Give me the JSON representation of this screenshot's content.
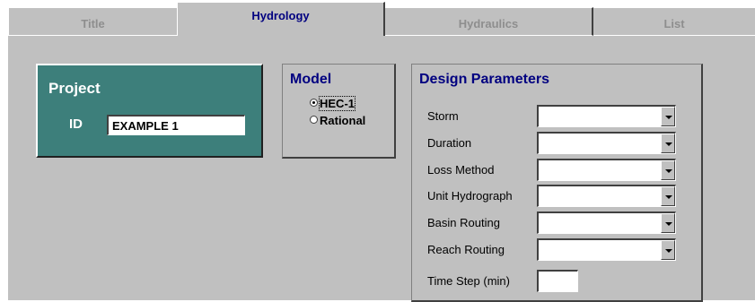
{
  "tabs": [
    {
      "label": "Title"
    },
    {
      "label": "Hydrology"
    },
    {
      "label": "Hydraulics"
    },
    {
      "label": "List"
    }
  ],
  "active_tab": "Hydrology",
  "colors": {
    "active_tab_text": "#000080",
    "inactive_tab_text": "#8e8e8e",
    "project_panel_bg": "#3d7f7b",
    "panel_title": "#000080",
    "window_bg": "#c0c0c0"
  },
  "project": {
    "title": "Project",
    "id_label": "ID",
    "id_value": "EXAMPLE 1"
  },
  "model": {
    "title": "Model",
    "options": [
      {
        "label": "HEC-1",
        "selected": true
      },
      {
        "label": "Rational",
        "selected": false
      }
    ]
  },
  "design_parameters": {
    "title": "Design Parameters",
    "fields": [
      {
        "label": "Storm",
        "value": ""
      },
      {
        "label": "Duration",
        "value": ""
      },
      {
        "label": "Loss Method",
        "value": ""
      },
      {
        "label": "Unit Hydrograph",
        "value": ""
      },
      {
        "label": "Basin Routing",
        "value": ""
      },
      {
        "label": "Reach Routing",
        "value": ""
      }
    ],
    "time_step": {
      "label": "Time Step (min)",
      "value": ""
    }
  },
  "icons": [
    "dropdown-arrow-icon",
    "radio-button-icon"
  ]
}
